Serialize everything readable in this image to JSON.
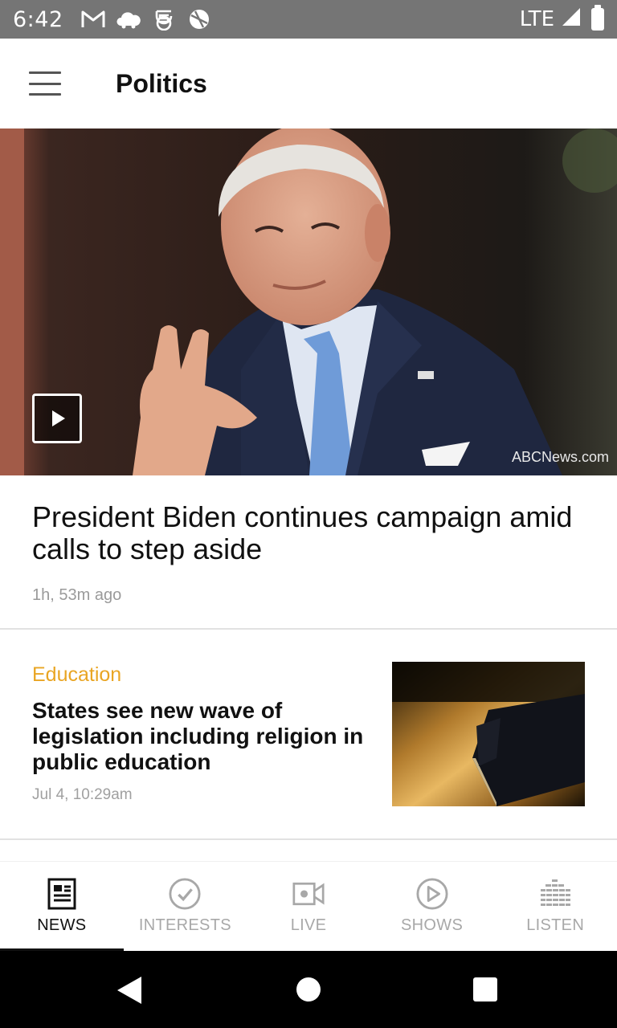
{
  "status_bar": {
    "time": "6:42",
    "network": "LTE",
    "icons": [
      "gmail-icon",
      "cloud-icon",
      "s-app-icon",
      "sports-ball-icon",
      "signal-icon",
      "battery-icon"
    ]
  },
  "app_bar": {
    "title": "Politics",
    "menu_icon": "hamburger-menu-icon"
  },
  "hero": {
    "credit": "ABCNews.com",
    "has_video": true
  },
  "lead_story": {
    "title": "President Biden continues campaign amid calls to step aside",
    "time": "1h, 53m ago"
  },
  "story": {
    "category": "Education",
    "title": "States see new wave of legislation including religion in public education",
    "time": "Jul 4, 10:29am"
  },
  "bottom_nav": {
    "items": [
      {
        "label": "NEWS",
        "icon": "newspaper-icon",
        "active": true
      },
      {
        "label": "INTERESTS",
        "icon": "checkmark-circle-icon",
        "active": false
      },
      {
        "label": "LIVE",
        "icon": "video-camera-icon",
        "active": false
      },
      {
        "label": "SHOWS",
        "icon": "play-circle-icon",
        "active": false
      },
      {
        "label": "LISTEN",
        "icon": "equalizer-icon",
        "active": false
      }
    ]
  },
  "colors": {
    "accent_category": "#e9a523",
    "status_bar": "#757575"
  }
}
